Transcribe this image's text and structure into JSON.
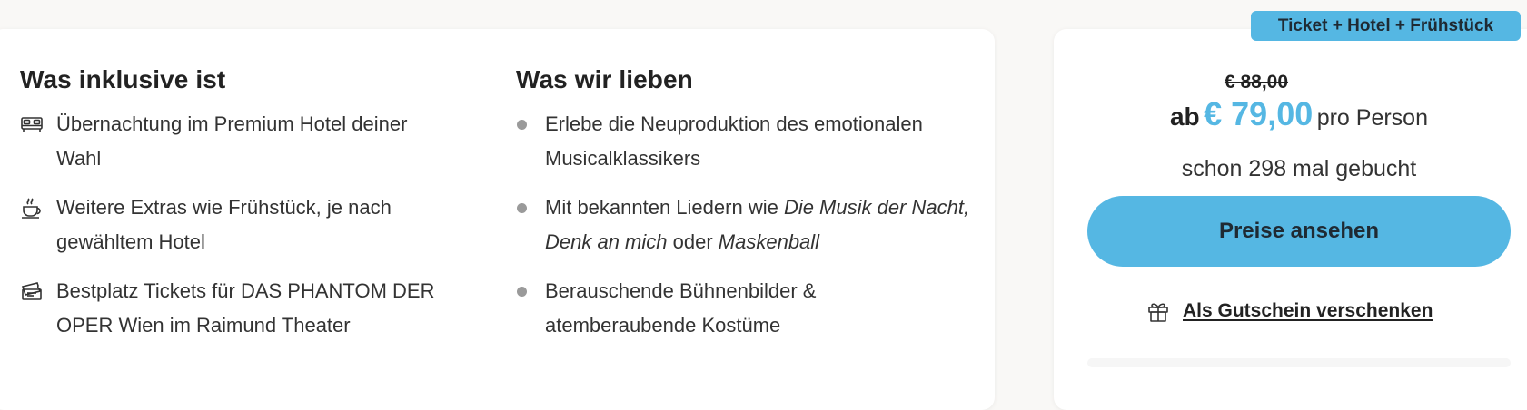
{
  "included": {
    "title": "Was inklusive ist",
    "items": [
      {
        "icon": "bed-icon",
        "text": "Übernachtung im Premium Hotel deiner Wahl"
      },
      {
        "icon": "coffee-cup-icon",
        "text": "Weitere Extras wie Frühstück, je nach gewähltem Hotel"
      },
      {
        "icon": "ticket-icon",
        "text": "Bestplatz Tickets für DAS PHANTOM DER OPER Wien im Raimund Theater"
      }
    ]
  },
  "loved": {
    "title": "Was wir lieben",
    "items": [
      {
        "text": "Erlebe die Neuproduktion des emotionalen Musicalklassikers"
      },
      {
        "text_a": "Mit bekannten Liedern wie ",
        "italic_a": "Die Musik der Nacht, Denk an mich",
        "text_b": " oder ",
        "italic_b": "Maskenball"
      },
      {
        "text": "Berauschende Bühnenbilder & atemberaubende Kostüme"
      }
    ]
  },
  "booking": {
    "badge": "Ticket + Hotel + Frühstück",
    "old_price": "€ 88,00",
    "price_prefix": "ab",
    "price": "€ 79,00",
    "price_suffix": "pro Person",
    "booked_text": "schon 298 mal gebucht",
    "cta_label": "Preise ansehen",
    "gift_label": "Als Gutschein verschenken",
    "gift_icon": "gift-icon"
  },
  "colors": {
    "accent": "#55b7e3",
    "text": "#222222",
    "bullet": "#9a9a9a",
    "background": "#f9f8f6"
  }
}
